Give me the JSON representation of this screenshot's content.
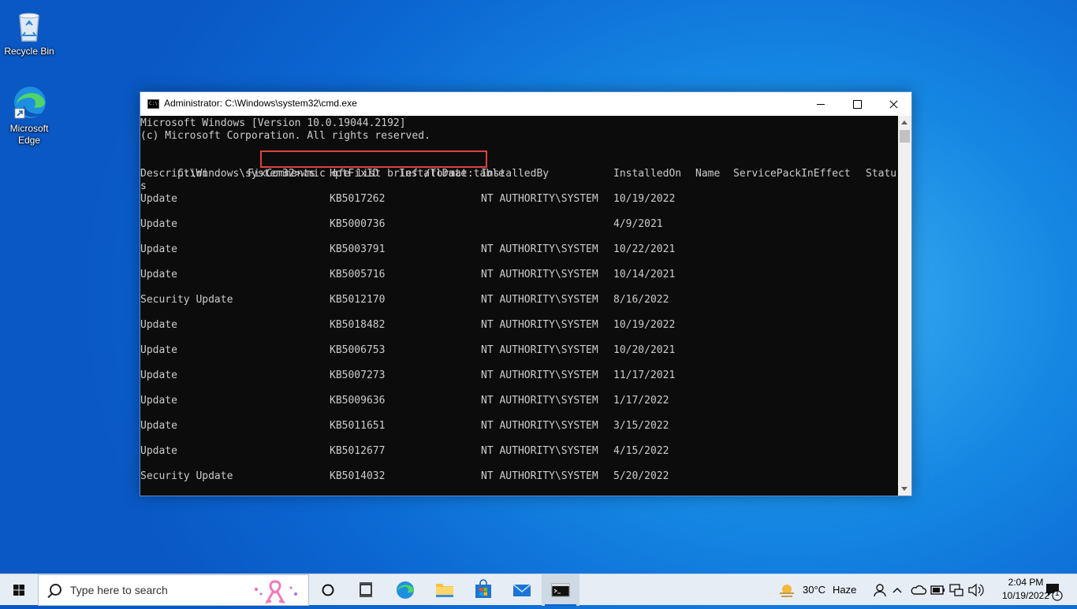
{
  "desktop": {
    "icons": [
      {
        "label": "Recycle Bin"
      },
      {
        "label": "Microsoft Edge"
      }
    ]
  },
  "window": {
    "title": "Administrator: C:\\Windows\\system32\\cmd.exe",
    "console": {
      "header_lines": [
        "Microsoft Windows [Version 10.0.19044.2192]",
        "(c) Microsoft Corporation. All rights reserved."
      ],
      "prompt": "C:\\Windows\\system32>",
      "command": "wmic qfe list brief /format:table",
      "columns": [
        "Description",
        "FixComments",
        "HotFixID",
        "InstallDate",
        "InstalledBy",
        "InstalledOn",
        "Name",
        "ServicePackInEffect",
        "Statu"
      ],
      "wrap_char": "s",
      "rows": [
        {
          "description": "Update",
          "hotfix": "KB5017262",
          "installed_by": "NT AUTHORITY\\SYSTEM",
          "installed_on": "10/19/2022"
        },
        {
          "description": "Update",
          "hotfix": "KB5000736",
          "installed_by": "",
          "installed_on": "4/9/2021"
        },
        {
          "description": "Update",
          "hotfix": "KB5003791",
          "installed_by": "NT AUTHORITY\\SYSTEM",
          "installed_on": "10/22/2021"
        },
        {
          "description": "Update",
          "hotfix": "KB5005716",
          "installed_by": "NT AUTHORITY\\SYSTEM",
          "installed_on": "10/14/2021"
        },
        {
          "description": "Security Update",
          "hotfix": "KB5012170",
          "installed_by": "NT AUTHORITY\\SYSTEM",
          "installed_on": "8/16/2022"
        },
        {
          "description": "Update",
          "hotfix": "KB5018482",
          "installed_by": "NT AUTHORITY\\SYSTEM",
          "installed_on": "10/19/2022"
        },
        {
          "description": "Update",
          "hotfix": "KB5006753",
          "installed_by": "NT AUTHORITY\\SYSTEM",
          "installed_on": "10/20/2021"
        },
        {
          "description": "Update",
          "hotfix": "KB5007273",
          "installed_by": "NT AUTHORITY\\SYSTEM",
          "installed_on": "11/17/2021"
        },
        {
          "description": "Update",
          "hotfix": "KB5009636",
          "installed_by": "NT AUTHORITY\\SYSTEM",
          "installed_on": "1/17/2022"
        },
        {
          "description": "Update",
          "hotfix": "KB5011651",
          "installed_by": "NT AUTHORITY\\SYSTEM",
          "installed_on": "3/15/2022"
        },
        {
          "description": "Update",
          "hotfix": "KB5012677",
          "installed_by": "NT AUTHORITY\\SYSTEM",
          "installed_on": "4/15/2022"
        },
        {
          "description": "Security Update",
          "hotfix": "KB5014032",
          "installed_by": "NT AUTHORITY\\SYSTEM",
          "installed_on": "5/20/2022"
        }
      ]
    }
  },
  "taskbar": {
    "search_placeholder": "Type here to search",
    "weather": {
      "temp": "30°C",
      "condition": "Haze"
    },
    "clock": {
      "time": "2:04 PM",
      "date": "10/19/2022"
    },
    "notification_count": "1"
  },
  "colors": {
    "highlight": "#e0413c",
    "console_bg": "#0c0c0c",
    "console_text": "#cccccc"
  }
}
